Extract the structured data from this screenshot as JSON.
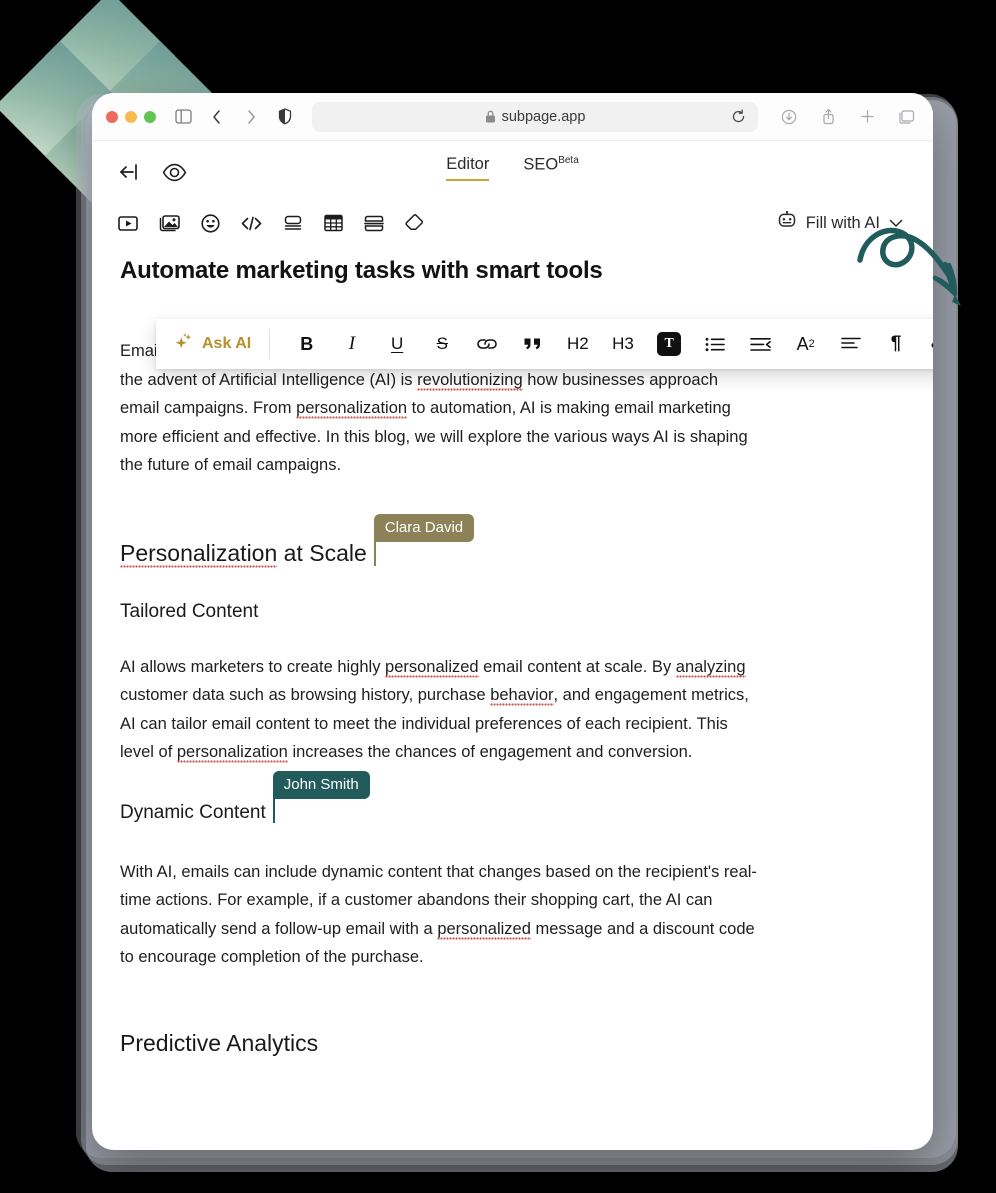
{
  "browser": {
    "url": "subpage.app",
    "lock_icon": "lock-icon",
    "traffic_lights": [
      "close-red",
      "minimize-yellow",
      "maximize-green"
    ],
    "left_icons": [
      "sidebar-toggle-icon",
      "back-icon",
      "forward-icon",
      "shield-icon"
    ],
    "right_icons": [
      "downloads-icon",
      "share-icon",
      "new-tab-icon",
      "tab-overview-icon"
    ],
    "reload_icon": "reload-icon"
  },
  "app": {
    "collapse_icon": "collapse-left-icon",
    "preview_icon": "eye-icon",
    "tabs": [
      {
        "label": "Editor",
        "active": true,
        "sup": ""
      },
      {
        "label": "SEO",
        "active": false,
        "sup": "Beta"
      }
    ]
  },
  "block_toolbar": {
    "tools": [
      {
        "name": "video-icon",
        "label": "Video"
      },
      {
        "name": "image-icon",
        "label": "Image"
      },
      {
        "name": "emoji-icon",
        "label": "Emoji"
      },
      {
        "name": "code-icon",
        "label": "Code"
      },
      {
        "name": "card-icon",
        "label": "Card"
      },
      {
        "name": "table-icon",
        "label": "Table"
      },
      {
        "name": "divider-icon",
        "label": "Divider"
      },
      {
        "name": "eraser-icon",
        "label": "Clear"
      }
    ],
    "fill_with_ai": {
      "label": "Fill with AI",
      "robot_icon": "robot-icon",
      "chevron_icon": "chevron-down-icon"
    }
  },
  "format_toolbar": {
    "ask_ai": {
      "label": "Ask AI",
      "icon": "sparkle-icon",
      "color": "#b8902c"
    },
    "buttons": [
      {
        "name": "bold-button",
        "label": "B",
        "kind": "bold"
      },
      {
        "name": "italic-button",
        "label": "I",
        "kind": "ital"
      },
      {
        "name": "underline-button",
        "label": "U",
        "kind": "und"
      },
      {
        "name": "strikethrough-button",
        "label": "S",
        "kind": "strike"
      },
      {
        "name": "link-button",
        "label": "",
        "kind": "link"
      },
      {
        "name": "quote-button",
        "label": "",
        "kind": "quote"
      },
      {
        "name": "heading-2-button",
        "label": "H2",
        "kind": "hx"
      },
      {
        "name": "heading-3-button",
        "label": "H3",
        "kind": "hx"
      },
      {
        "name": "text-style-button",
        "label": "T",
        "kind": "tbox",
        "active": true
      },
      {
        "name": "bullet-list-button",
        "label": "",
        "kind": "bullets"
      },
      {
        "name": "indent-button",
        "label": "",
        "kind": "indent"
      },
      {
        "name": "superscript-button",
        "label": "A",
        "sup": "2",
        "kind": "sup"
      },
      {
        "name": "align-left-button",
        "label": "",
        "kind": "align"
      },
      {
        "name": "paragraph-button",
        "label": "¶",
        "kind": "pilcrow"
      },
      {
        "name": "clear-format-button",
        "label": "",
        "kind": "eraser"
      }
    ]
  },
  "document": {
    "title": "Automate marketing tasks with smart tools",
    "paragraph_1": {
      "seg_a": "Email marketing has long been a cornerstone of digital marketing strategies. However, the advent of Artificial Intelligence (AI) is ",
      "misspelled_1": "revolutionizing",
      "seg_b": " how businesses approach email campaigns. From ",
      "misspelled_2": "personalization",
      "seg_c": " to automation, AI is making email marketing more efficient and effective. In this blog, we will explore the various ways AI is shaping the future of email campaigns."
    },
    "heading_personalization": {
      "misspelled": "Personalization",
      "rest": " at Scale"
    },
    "subheading_tailored": "Tailored Content",
    "paragraph_2": {
      "seg_a": "AI allows marketers to create highly ",
      "misspelled_1": "personalized",
      "seg_b": " email content at scale. By ",
      "misspelled_2": "analyzing",
      "seg_c": " customer data such as browsing history, purchase ",
      "misspelled_3": "behavior",
      "seg_d": ", and engagement metrics, AI can tailor email content to meet the individual preferences of each recipient. This level of ",
      "misspelled_4": "personalization",
      "seg_e": " increases the chances of engagement and conversion."
    },
    "subheading_dynamic": "Dynamic Content",
    "paragraph_3": {
      "seg_a": "With AI, emails can include dynamic content that changes based on the recipient's real-time actions. For example, if a customer abandons their shopping cart, the AI can automatically send a follow-up email with a ",
      "misspelled_1": "personalized",
      "seg_b": " message and a discount code to encourage completion of the purchase."
    },
    "heading_predictive": "Predictive Analytics"
  },
  "collaborators": [
    {
      "name": "Clara David",
      "color": "#8d8158"
    },
    {
      "name": "John Smith",
      "color": "#225b5b"
    }
  ],
  "decor": {
    "diamond_gradient": [
      "#6d9b97",
      "#cfe0cd"
    ],
    "arrow_color": "#225b5b",
    "arrow_icon": "curly-arrow-icon"
  }
}
